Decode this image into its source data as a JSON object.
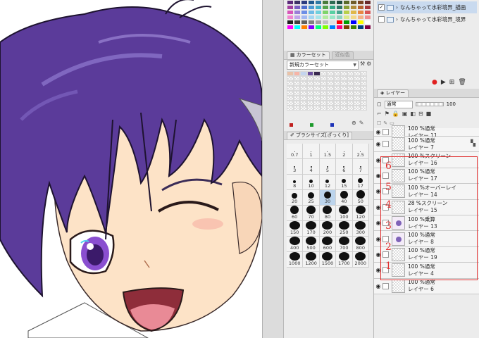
{
  "colors": {
    "accent_red": "#e03030",
    "hair": "#5b3b9a",
    "skin": "#fde3c7",
    "eye": "#b56ad8"
  },
  "swatches": [
    "#5b2a7a",
    "#3d3266",
    "#2c3d80",
    "#1f5a8f",
    "#2f7aa5",
    "#4a7b3b",
    "#2e6b52",
    "#1e4f42",
    "#5a6b2a",
    "#705c2a",
    "#7a4422",
    "#6a2a2a",
    "#a43fa0",
    "#7a5fc2",
    "#4e6fcf",
    "#4d9ad6",
    "#40b0c7",
    "#55a54a",
    "#34a883",
    "#307a68",
    "#8aa036",
    "#b08c3a",
    "#b86430",
    "#a83b3b",
    "#d855b9",
    "#9b7ed8",
    "#6d8fe6",
    "#6ebbe6",
    "#6fd0dd",
    "#7ed46a",
    "#58d0a3",
    "#48a690",
    "#b9d04a",
    "#e0b84a",
    "#e88742",
    "#d85555",
    "#f186d1",
    "#c1a5ea",
    "#a3b9f2",
    "#a4d6f2",
    "#a6e5ea",
    "#b3eca1",
    "#9ae8c8",
    "#8fd2bf",
    "#dcea8a",
    "#f3d98a",
    "#f5b385",
    "#f08f8f",
    "#202020",
    "#404040",
    "#606060",
    "#808080",
    "#a0a0a0",
    "#c0c0c0",
    "#e0e0e0",
    "#ff0000",
    "#00a000",
    "#0000ff",
    "#ffff00",
    "#ffffff",
    "#ff00ff",
    "#00ffff",
    "#ff8000",
    "#8000ff",
    "#00ff80",
    "#80ff00",
    "#0080ff",
    "#ff0080",
    "#804000",
    "#408000",
    "#004080",
    "#800040"
  ],
  "color_set": {
    "tab_label": "カラーセット",
    "tab_inactive": "近似色",
    "selected": "新規カラーセット"
  },
  "brush_size": {
    "tab_label": "ブラシサイズ[ざっくり]",
    "cells": [
      {
        "label": "0.7",
        "size": 1
      },
      {
        "label": "1",
        "size": 1
      },
      {
        "label": "1.5",
        "size": 1
      },
      {
        "label": "2",
        "size": 1
      },
      {
        "label": "2.5",
        "size": 1
      },
      {
        "label": "3",
        "size": 2
      },
      {
        "label": "4",
        "size": 2
      },
      {
        "label": "5",
        "size": 2
      },
      {
        "label": "6",
        "size": 2
      },
      {
        "label": "7",
        "size": 2
      },
      {
        "label": "8",
        "size": 4
      },
      {
        "label": "10",
        "size": 5
      },
      {
        "label": "12",
        "size": 5
      },
      {
        "label": "15",
        "size": 6
      },
      {
        "label": "17",
        "size": 7
      },
      {
        "label": "20",
        "size": 8
      },
      {
        "label": "25",
        "size": 9
      },
      {
        "label": "30",
        "size": 10
      },
      {
        "label": "40",
        "size": 11
      },
      {
        "label": "50",
        "size": 12
      },
      {
        "label": "60",
        "size": 12
      },
      {
        "label": "70",
        "size": 13
      },
      {
        "label": "80",
        "size": 13
      },
      {
        "label": "100",
        "size": 14
      },
      {
        "label": "120",
        "size": 14
      },
      {
        "label": "150",
        "size": 15
      },
      {
        "label": "170",
        "size": 15
      },
      {
        "label": "200",
        "size": 15
      },
      {
        "label": "250",
        "size": 15
      },
      {
        "label": "300",
        "size": 15
      },
      {
        "label": "400",
        "size": 15
      },
      {
        "label": "500",
        "size": 15
      },
      {
        "label": "600",
        "size": 15
      },
      {
        "label": "700",
        "size": 15
      },
      {
        "label": "800",
        "size": 15
      },
      {
        "label": "1000",
        "size": 15
      },
      {
        "label": "1200",
        "size": 15
      },
      {
        "label": "1500",
        "size": 15
      },
      {
        "label": "1700",
        "size": 15
      },
      {
        "label": "2000",
        "size": 15
      }
    ],
    "selected_label": "30"
  },
  "auto_actions": [
    {
      "label": "なんちゃって水彩境界_描画",
      "checked": true,
      "selected": true
    },
    {
      "label": "なんちゃって水彩境界_境界",
      "checked": false,
      "selected": false
    }
  ],
  "layer_panel": {
    "tab_label": "レイヤー",
    "blend_mode": "通常",
    "opacity": "100"
  },
  "layers": [
    {
      "blend": "100 %通常",
      "name": "レイヤー 11",
      "thumb": "blank",
      "partial": true
    },
    {
      "blend": "100 %通常",
      "name": "レイヤー 7",
      "thumb": "blank"
    },
    {
      "blend": "100 %スクリーン",
      "name": "レイヤー 16",
      "thumb": "blank"
    },
    {
      "blend": "100 %通常",
      "name": "レイヤー 17",
      "thumb": "blank"
    },
    {
      "blend": "100 %オーバーレイ",
      "name": "レイヤー 14",
      "thumb": "blank"
    },
    {
      "blend": "28 %スクリーン",
      "name": "レイヤー 15",
      "thumb": "blank"
    },
    {
      "blend": "100 %乗算",
      "name": "レイヤー 13",
      "thumb": "art"
    },
    {
      "blend": "100 %通常",
      "name": "レイヤー 8",
      "thumb": "art"
    },
    {
      "blend": "100 %通常",
      "name": "レイヤー 19",
      "thumb": "blank"
    },
    {
      "blend": "100 %通常",
      "name": "レイヤー 4",
      "thumb": "blank"
    },
    {
      "blend": "100 %通常",
      "name": "レイヤー 6",
      "thumb": "blank"
    }
  ],
  "annotation_numbers": [
    "6",
    "5",
    "4",
    "3",
    "2",
    "1"
  ]
}
